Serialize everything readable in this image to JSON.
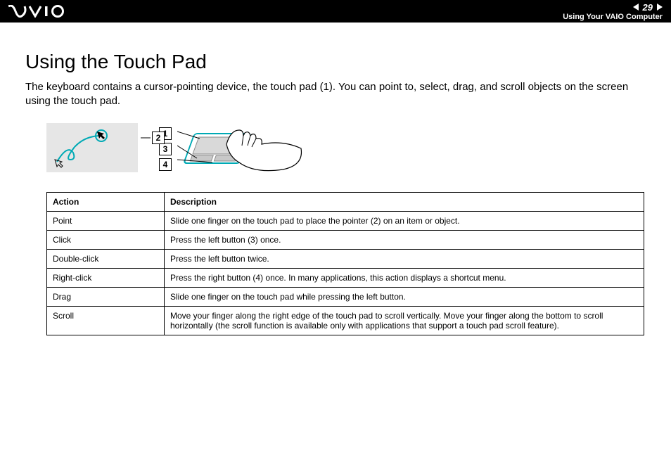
{
  "header": {
    "page_number": "29",
    "section": "Using Your VAIO Computer"
  },
  "title": "Using the Touch Pad",
  "intro": "The keyboard contains a cursor-pointing device, the touch pad (1). You can point to, select, drag, and scroll objects on the screen using the touch pad.",
  "diagram": {
    "label_pointer": "2",
    "label_touchpad": "1",
    "label_leftbtn": "3",
    "label_rightbtn": "4"
  },
  "table": {
    "head_action": "Action",
    "head_desc": "Description",
    "rows": [
      {
        "action": "Point",
        "desc": "Slide one finger on the touch pad to place the pointer (2) on an item or object."
      },
      {
        "action": "Click",
        "desc": "Press the left button (3) once."
      },
      {
        "action": "Double-click",
        "desc": "Press the left button twice."
      },
      {
        "action": "Right-click",
        "desc": "Press the right button (4) once. In many applications, this action displays a shortcut menu."
      },
      {
        "action": "Drag",
        "desc": "Slide one finger on the touch pad while pressing the left button."
      },
      {
        "action": "Scroll",
        "desc": "Move your finger along the right edge of the touch pad to scroll vertically. Move your finger along the bottom to scroll horizontally (the scroll function is available only with applications that support a touch pad scroll feature)."
      }
    ]
  }
}
